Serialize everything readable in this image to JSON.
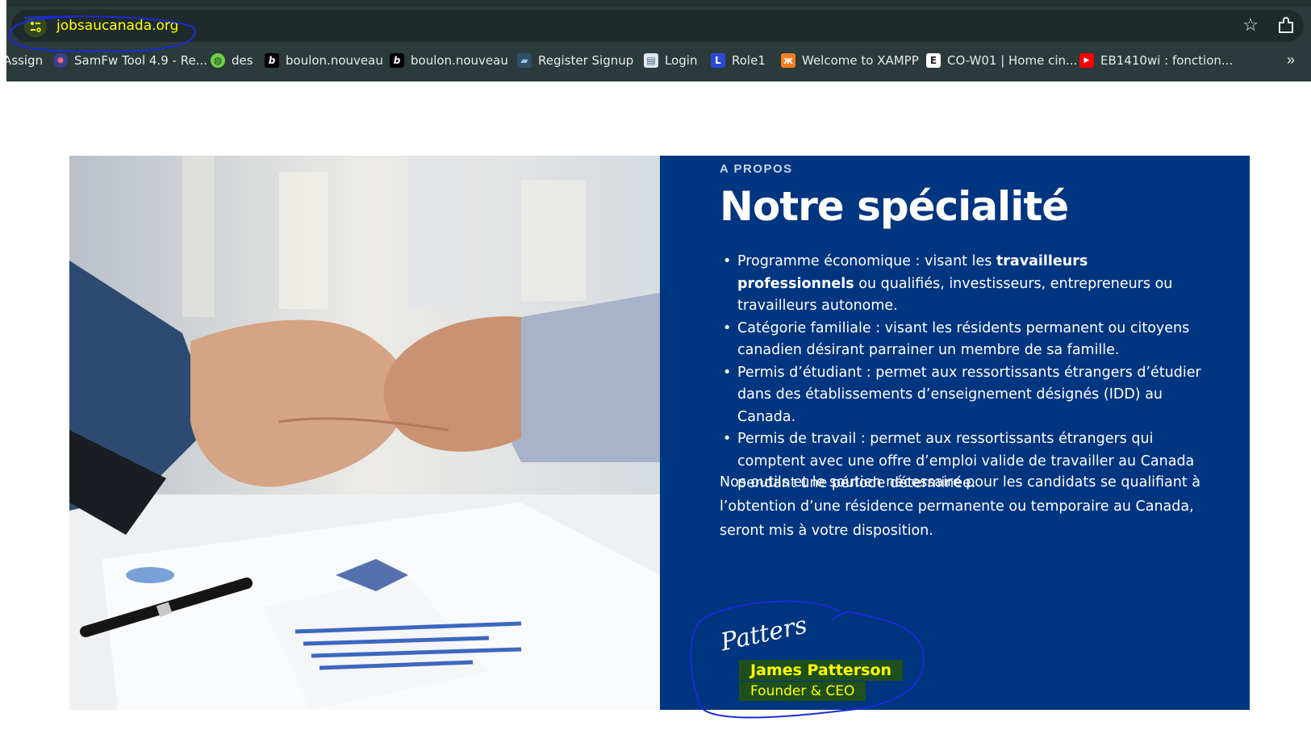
{
  "browser": {
    "url": "jobsaucanada.org",
    "bookmarks": [
      {
        "label": "Assign",
        "icon": "none"
      },
      {
        "label": "SamFw Tool 4.9 - Re...",
        "icon": "samfw-icon"
      },
      {
        "label": "des",
        "icon": "globe-icon"
      },
      {
        "label": "boulon.nouveau",
        "icon": "b-icon"
      },
      {
        "label": "boulon.nouveau",
        "icon": "b-icon"
      },
      {
        "label": "Register  Signup",
        "icon": "register-icon"
      },
      {
        "label": "Login",
        "icon": "page-icon"
      },
      {
        "label": "Role1",
        "icon": "role-icon"
      },
      {
        "label": "Welcome to XAMPP",
        "icon": "xampp-icon"
      },
      {
        "label": "CO-W01 | Home cin...",
        "icon": "e-icon"
      },
      {
        "label": "EB1410wi : fonction...",
        "icon": "youtube-icon"
      }
    ]
  },
  "section": {
    "kicker": "A PROPOS",
    "title": "Notre spécialité",
    "bullets": [
      {
        "pre": "Programme économique : visant les ",
        "bold": "travailleurs professionnels",
        "post": " ou qualifiés, investisseurs, entrepreneurs ou travailleurs autonome."
      },
      {
        "pre": "Catégorie familiale : visant les résidents permanent ou citoyens canadien désirant parrainer un membre de sa famille.",
        "bold": "",
        "post": ""
      },
      {
        "pre": "Permis d’étudiant : permet aux ressortissants étrangers d’étudier dans des établissements d’enseignement désignés (IDD) au Canada.",
        "bold": "",
        "post": ""
      },
      {
        "pre": "Permis de travail : permet aux ressortissants étrangers qui comptent avec une offre d’emploi valide de travailler au Canada pendant une période déterminée.",
        "bold": "",
        "post": ""
      }
    ],
    "paragraph": "Nos outils et le soutien nécessaire pour les candidats se qualifiant à l’obtention d’une résidence permanente ou temporaire au Canada, seront mis à votre disposition.",
    "signature": "Patterson",
    "founder_name": "James Patterson",
    "founder_role": "Founder & CEO"
  },
  "colors": {
    "panel": "#003580",
    "highlight_text": "#ffff00",
    "highlight_bg": "#1f4f1a"
  }
}
